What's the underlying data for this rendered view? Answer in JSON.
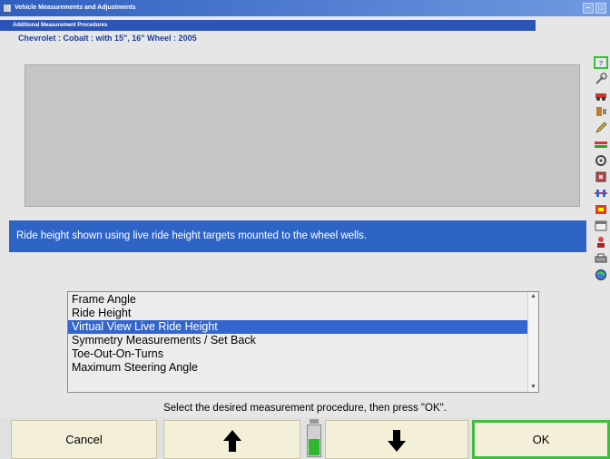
{
  "window": {
    "title": "Vehicle Measurements and Adjustments",
    "buttons": [
      "–",
      "□"
    ]
  },
  "header": {
    "section": "Additional Measurement Procedures",
    "vehicle": "Chevrolet : Cobalt : with 15\", 16\" Wheel : 2005"
  },
  "description": "Ride height shown using live ride height targets mounted to the wheel wells.",
  "procedures": {
    "items": [
      "Frame Angle",
      "Ride Height",
      "Virtual View Live Ride Height",
      "Symmetry Measurements / Set Back",
      "Toe-Out-On-Turns",
      "Maximum Steering Angle"
    ],
    "selected_index": 2,
    "scroll_up": "▲",
    "scroll_down": "▼"
  },
  "instruction": "Select the desired measurement procedure, then press \"OK\".",
  "footer": {
    "cancel_label": "Cancel",
    "up_icon": "up-arrow-icon",
    "down_icon": "down-arrow-icon",
    "ok_label": "OK",
    "position_level": 0.55
  },
  "colors": {
    "titlebar": "#2f5fbf",
    "selection": "#3366cc",
    "description_bar": "#2f64c7",
    "ok_border": "#3fbf3f",
    "button_face": "#f3efd8"
  },
  "toolbar": {
    "icons": [
      "help-icon",
      "wrench-icon",
      "car-icon",
      "sensor-icon",
      "pencil-icon",
      "measure-icon",
      "wheel-icon",
      "clamp-icon",
      "alignment-icon",
      "target-icon",
      "calendar-icon",
      "person-icon",
      "print-icon",
      "globe-icon"
    ]
  }
}
